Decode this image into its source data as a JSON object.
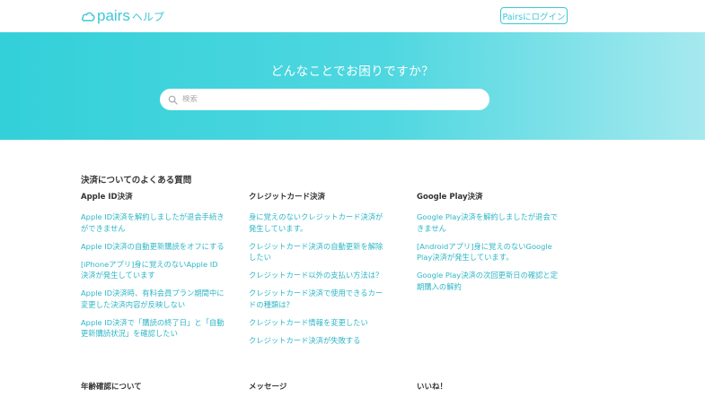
{
  "header": {
    "logo_text": "pairs",
    "logo_sub": "ヘルプ",
    "login_label": "Pairsにログイン"
  },
  "hero": {
    "title": "どんなことでお困りですか？",
    "search_placeholder": "検索"
  },
  "sections": [
    {
      "title": "決済についてのよくある質問",
      "columns": [
        {
          "title": "Apple ID決済",
          "links": [
            "Apple ID決済を解約しましたが退会手続きができません",
            "Apple ID決済の自動更新購読をオフにする",
            "[iPhoneアプリ]身に覚えのないApple ID決済が発生しています",
            "Apple ID決済時、有料会員プラン期間中に変更した決済内容が反映しない",
            "Apple ID決済で「購読の終了日」と「自動更新購読状況」を確認したい"
          ]
        },
        {
          "title": "クレジットカード決済",
          "links": [
            "身に覚えのないクレジットカード決済が発生しています。",
            "クレジットカード決済の自動更新を解除したい",
            "クレジットカード以外の支払い方法は？",
            "クレジットカード決済で使用できるカードの種類は？",
            "クレジットカード情報を変更したい",
            "クレジットカード決済が失敗する"
          ]
        },
        {
          "title": "Google Play決済",
          "links": [
            "Google Play決済を解約しましたが退会できません",
            "[Androidアプリ]身に覚えのないGoogle Play決済が発生しています。",
            "Google Play決済の次回更新日の確認と定期購入の解約"
          ]
        }
      ]
    },
    {
      "columns": [
        {
          "title": "年齢確認について"
        },
        {
          "title": "メッセージ"
        },
        {
          "title": "いいね！"
        }
      ]
    }
  ]
}
